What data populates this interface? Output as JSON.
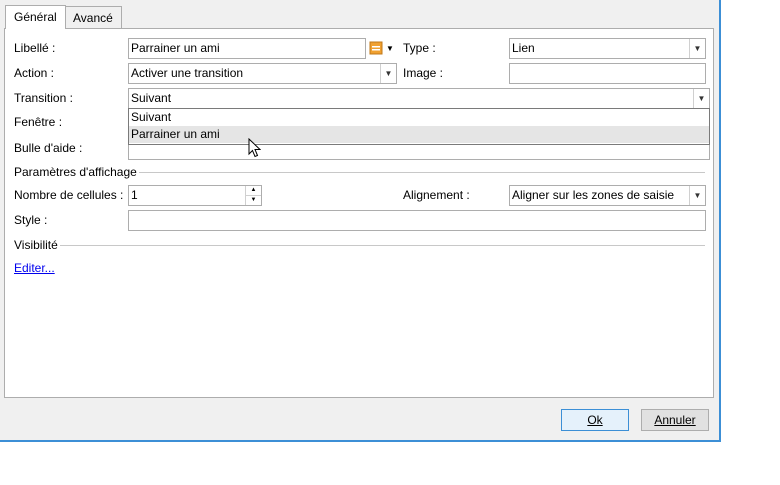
{
  "tabs": [
    {
      "label": "Général"
    },
    {
      "label": "Avancé"
    }
  ],
  "form": {
    "libelle_label": "Libellé :",
    "libelle_value": "Parrainer un ami",
    "type_label": "Type :",
    "type_value": "Lien",
    "action_label": "Action :",
    "action_value": "Activer une transition",
    "image_label": "Image :",
    "image_value": "",
    "transition_label": "Transition :",
    "transition_value": "Suivant",
    "fenetre_label": "Fenêtre :",
    "bulle_label": "Bulle d'aide :"
  },
  "dropdown": {
    "options": [
      "Suivant",
      "Parrainer un ami"
    ],
    "hovered_index": 1
  },
  "display": {
    "section_title": "Paramètres d'affichage",
    "cells_label": "Nombre de cellules :",
    "cells_value": "1",
    "alignment_label": "Alignement :",
    "alignment_value": "Aligner sur les zones de saisie",
    "style_label": "Style :",
    "style_value": ""
  },
  "visibility": {
    "section_title": "Visibilité",
    "edit_link": "Editer..."
  },
  "buttons": {
    "ok": "Ok",
    "cancel": "Annuler"
  },
  "colors": {
    "accent": "#3c8fd6",
    "link": "#0000ee",
    "icon_orange": "#f0a030"
  }
}
